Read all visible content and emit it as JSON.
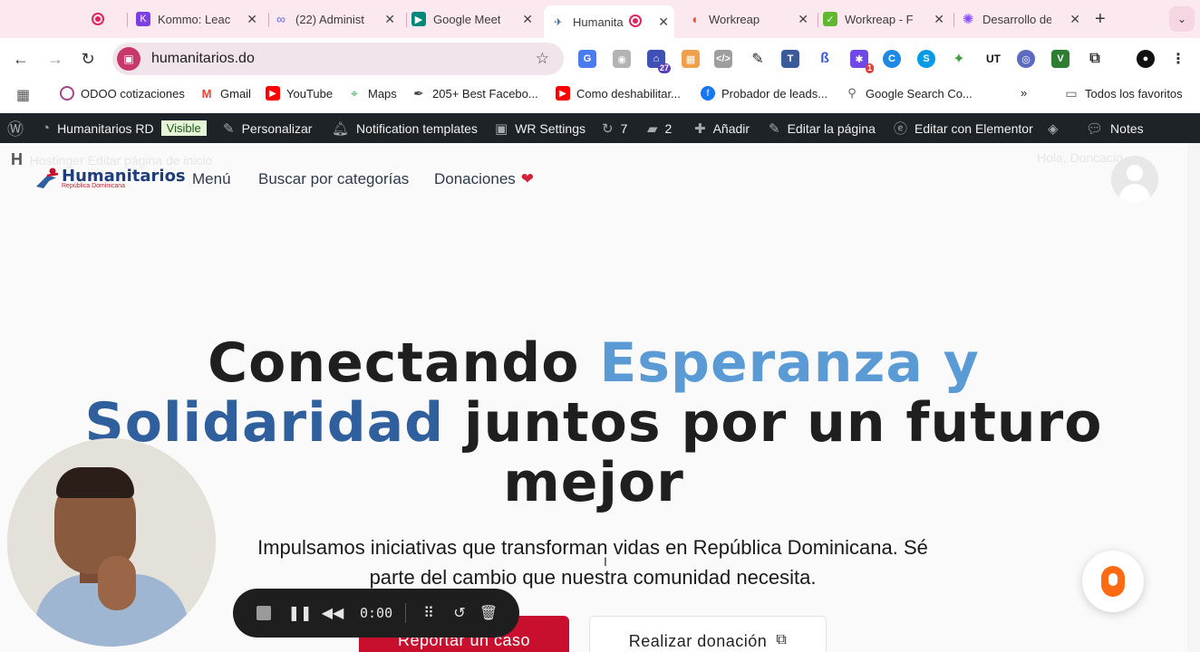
{
  "browser": {
    "tabs": [
      {
        "title": "",
        "active": false,
        "icon": "record-icon",
        "color": "#e0245e"
      },
      {
        "title": "Kommo: Leac",
        "active": false,
        "icon": "kommo-icon",
        "color": "#7b3fe4"
      },
      {
        "title": "(22) Administ",
        "active": false,
        "icon": "meta-icon",
        "color": "#5a6ee0"
      },
      {
        "title": "Google Meet",
        "active": false,
        "icon": "meet-icon",
        "color": "#00897b"
      },
      {
        "title": "Humanita",
        "active": true,
        "icon": "humanitarios-icon",
        "color": "#c8102e"
      },
      {
        "title": "Workreap",
        "active": false,
        "icon": "workreap-icon",
        "color": "#e94b3c"
      },
      {
        "title": "Workreap - F",
        "active": false,
        "icon": "workreap-green-icon",
        "color": "#5fb82f"
      },
      {
        "title": "Desarrollo de",
        "active": false,
        "icon": "clickup-icon",
        "color": "#8a4fff"
      }
    ],
    "url": "humanitarios.do",
    "bookmarks": [
      {
        "label": "ODOO cotizaciones",
        "icon": "odoo-icon",
        "color": "#a24689"
      },
      {
        "label": "Gmail",
        "icon": "gmail-icon",
        "color": "#ea4335"
      },
      {
        "label": "YouTube",
        "icon": "youtube-icon",
        "color": "#ff0000"
      },
      {
        "label": "Maps",
        "icon": "maps-icon",
        "color": "#34a853"
      },
      {
        "label": "205+ Best Facebo...",
        "icon": "feather-icon",
        "color": "#444444"
      },
      {
        "label": "Como deshabilitar...",
        "icon": "youtube-icon",
        "color": "#ff0000"
      },
      {
        "label": "Probador de leads...",
        "icon": "facebook-icon",
        "color": "#1877f2"
      },
      {
        "label": "Google Search Co...",
        "icon": "search-console-icon",
        "color": "#5f6368"
      }
    ],
    "all_bookmarks": "Todos los favoritos",
    "ext_badges": {
      "ext1": "27",
      "ext2": "1"
    }
  },
  "admin_bar": {
    "site": "Humanitarios RD",
    "visible": "Visible",
    "customize": "Personalizar",
    "notifications": "Notification templates",
    "wr_settings": "WR Settings",
    "updates": "7",
    "comments": "2",
    "add": "Añadir",
    "edit_page": "Editar la página",
    "elementor": "Editar con Elementor",
    "notes": "Notes"
  },
  "site": {
    "ghost_left": "Hostinger    Editar página de inicio",
    "ghost_right": "Hola, Doncacio",
    "logo_name": "Humanitarios",
    "logo_sub": "República Dominicana",
    "nav": [
      "Menú",
      "Buscar por categorías",
      "Donaciones"
    ],
    "hero": {
      "part1": "Conectando ",
      "part2": "Esperanza y",
      "part3": "Solidaridad",
      "part4": " juntos por un futuro",
      "part5": "mejor"
    },
    "lead": "Impulsamos iniciativas que transforman vidas en República Dominicana. Sé parte del cambio que nuestra comunidad necesita.",
    "btn_report": "Reportar un caso",
    "btn_donate": "Realizar donación"
  },
  "recorder": {
    "time": "0:00"
  },
  "colors": {
    "accent_red": "#c8102e",
    "hero_light_blue": "#5b9bd5",
    "hero_dark_blue": "#2f5f9c",
    "admin_bar": "#1d2327"
  }
}
